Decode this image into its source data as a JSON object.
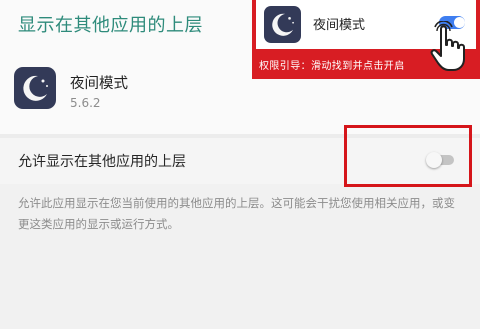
{
  "page": {
    "title": "显示在其他应用的上层"
  },
  "app": {
    "name": "夜间模式",
    "version": "5.6.2",
    "icon": "crescent-moon-star-icon"
  },
  "permission": {
    "label": "允许显示在其他应用的上层",
    "enabled": false,
    "description": "允许此应用显示在您当前使用的其他应用的上层。这可能会干扰您使用相关应用，或变更这类应用的显示或运行方式。"
  },
  "guide": {
    "app_name": "夜间模式",
    "toggle_enabled": true,
    "hint": "权限引导：滑动找到并点击开启",
    "icon": "hand-pointer-icon"
  },
  "colors": {
    "accent_title": "#2e8b7b",
    "guide_red": "#d81d23",
    "toggle_on": "#3f7ef0",
    "app_icon_bg": "#333a58"
  }
}
